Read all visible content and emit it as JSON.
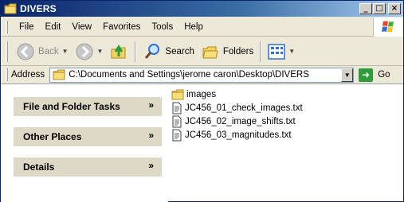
{
  "window": {
    "title": "DIVERS"
  },
  "menu": {
    "items": [
      "File",
      "Edit",
      "View",
      "Favorites",
      "Tools",
      "Help"
    ]
  },
  "toolbar": {
    "back_label": "Back",
    "search_label": "Search",
    "folders_label": "Folders"
  },
  "address": {
    "label": "Address",
    "value": "C:\\Documents and Settings\\jerome caron\\Desktop\\DIVERS",
    "go_label": "Go"
  },
  "task_pane": {
    "groups": [
      {
        "title": "File and Folder Tasks"
      },
      {
        "title": "Other Places"
      },
      {
        "title": "Details"
      }
    ]
  },
  "files": [
    {
      "name": "images",
      "type": "folder"
    },
    {
      "name": "JC456_01_check_images.txt",
      "type": "text"
    },
    {
      "name": "JC456_02_image_shifts.txt",
      "type": "text"
    },
    {
      "name": "JC456_03_magnitudes.txt",
      "type": "text"
    }
  ],
  "colors": {
    "title_bar": "#0a246a",
    "task_header": "#ddd9c6",
    "go_green": "#2e9c3a"
  }
}
